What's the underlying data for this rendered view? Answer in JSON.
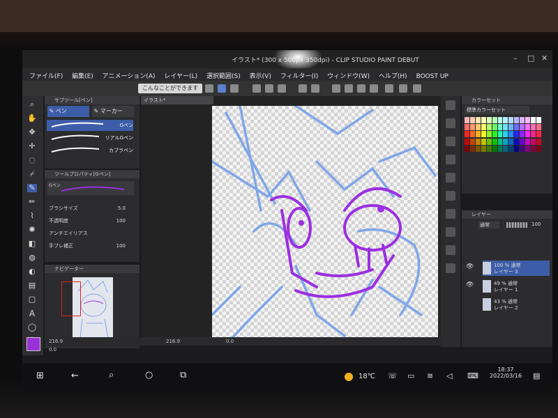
{
  "titlebar": {
    "title": "イラスト* (300 x 500px 350dpi) - CLIP STUDIO PAINT DEBUT",
    "controls": [
      "–",
      "□",
      "✕"
    ]
  },
  "menu": [
    "ファイル(F)",
    "編集(E)",
    "アニメーション(A)",
    "レイヤー(L)",
    "選択範囲(S)",
    "表示(V)",
    "フィルター(I)",
    "ウィンドウ(W)",
    "ヘルプ(H)",
    "BOOST UP"
  ],
  "command_bar": {
    "help_button": "こんなことができます"
  },
  "sub_tool": {
    "header": "サブツール[ペン]",
    "tabs": [
      "ペン",
      "マーカー"
    ],
    "brushes": [
      "Gペン",
      "リアルGペン",
      "カブラペン"
    ]
  },
  "tool_property": {
    "header": "ツールプロパティ[Gペン]",
    "brush_name": "Gペン",
    "rows": [
      {
        "label": "ブラシサイズ",
        "value": "5.0"
      },
      {
        "label": "不透明度",
        "value": "100"
      },
      {
        "label": "アンチエイリアス",
        "value": ""
      },
      {
        "label": "手ブレ補正",
        "value": "100"
      }
    ]
  },
  "navigator": {
    "header": "ナビゲーター"
  },
  "document_tab": "イラスト*",
  "status": {
    "zoom_left": "216.9",
    "zoom_canvas": "216.9",
    "angle_left": "0.0",
    "angle_canvas": "0.0"
  },
  "color_set": {
    "header": "カラーセット",
    "dropdown": "標準カラーセット"
  },
  "layer_panel": {
    "header": "レイヤー",
    "blend_mode": "通常",
    "opacity": "100",
    "layers": [
      {
        "opacity_mode": "100 % 通常",
        "name": "レイヤー 3",
        "selected": true,
        "visible": true
      },
      {
        "opacity_mode": "49 % 通常",
        "name": "レイヤー 1",
        "selected": false,
        "visible": true
      },
      {
        "opacity_mode": "43 % 通常",
        "name": "レイヤー 2",
        "selected": false,
        "visible": false
      }
    ]
  },
  "taskbar": {
    "weather": "18℃",
    "time": "18:37",
    "date": "2022/03/16"
  },
  "colors": {
    "main_color": "#9a31d8",
    "sketch_blue": "#7fa6e8",
    "lineart_purple": "#9b2fe0",
    "selection": "#3d5da8"
  }
}
